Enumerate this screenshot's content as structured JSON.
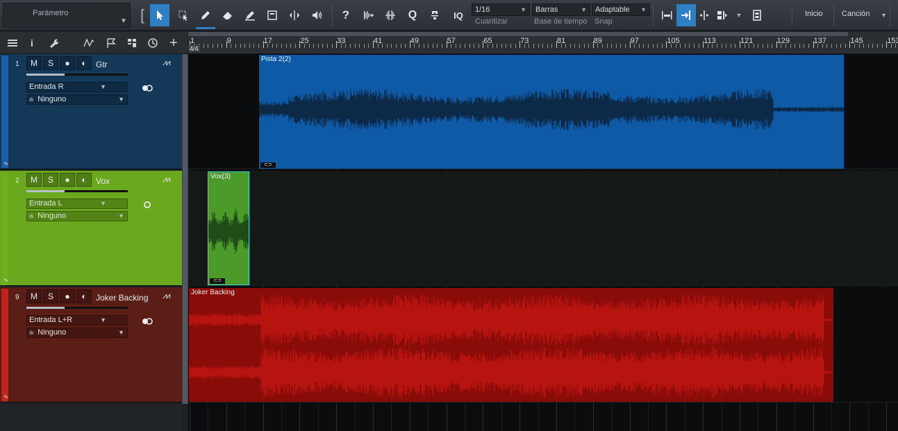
{
  "toolbar": {
    "parameter_label": "Parámetro",
    "quantize_value": "1/16",
    "quantize_label": "Cuantizar",
    "timebase_value": "Barras",
    "timebase_label": "Base de tiempo",
    "snap_value": "Adaptable",
    "snap_label": "Snap",
    "start_button": "Inicio",
    "song_button": "Canción",
    "iq_label": "IQ"
  },
  "ruler": {
    "time_signature": "4/4",
    "bars": [
      "1",
      "9",
      "17",
      "25",
      "33",
      "41",
      "49",
      "57",
      "65",
      "73",
      "81",
      "89",
      "97",
      "105",
      "113",
      "121",
      "129",
      "137",
      "145",
      "153"
    ]
  },
  "tracks": [
    {
      "number": "1",
      "name": "Gtr",
      "color": "#1a5fa8",
      "header_bg": "#143858",
      "input": "Entrada R",
      "output": "Ninguno",
      "mute": "M",
      "solo": "S",
      "clip_name": "Pista 2(2)",
      "clip_color": "#0f5aa6",
      "wave_color": "#0c2a48"
    },
    {
      "number": "2",
      "name": "Vox",
      "color": "#6fae1c",
      "header_bg": "#6aa91d",
      "input": "Entrada L",
      "output": "Ninguno",
      "mute": "M",
      "solo": "S",
      "clip_name": "Vox(3)",
      "clip_color": "#4b9a2a",
      "wave_color": "#1f4c17"
    },
    {
      "number": "9",
      "name": "Joker Backing",
      "color": "#c0241c",
      "header_bg": "#5a1e17",
      "input": "Entrada L+R",
      "output": "Ninguno",
      "mute": "M",
      "solo": "S",
      "clip_name": "Joker Backing",
      "clip_color": "#8a0c08",
      "wave_color": "#b8140f"
    }
  ]
}
